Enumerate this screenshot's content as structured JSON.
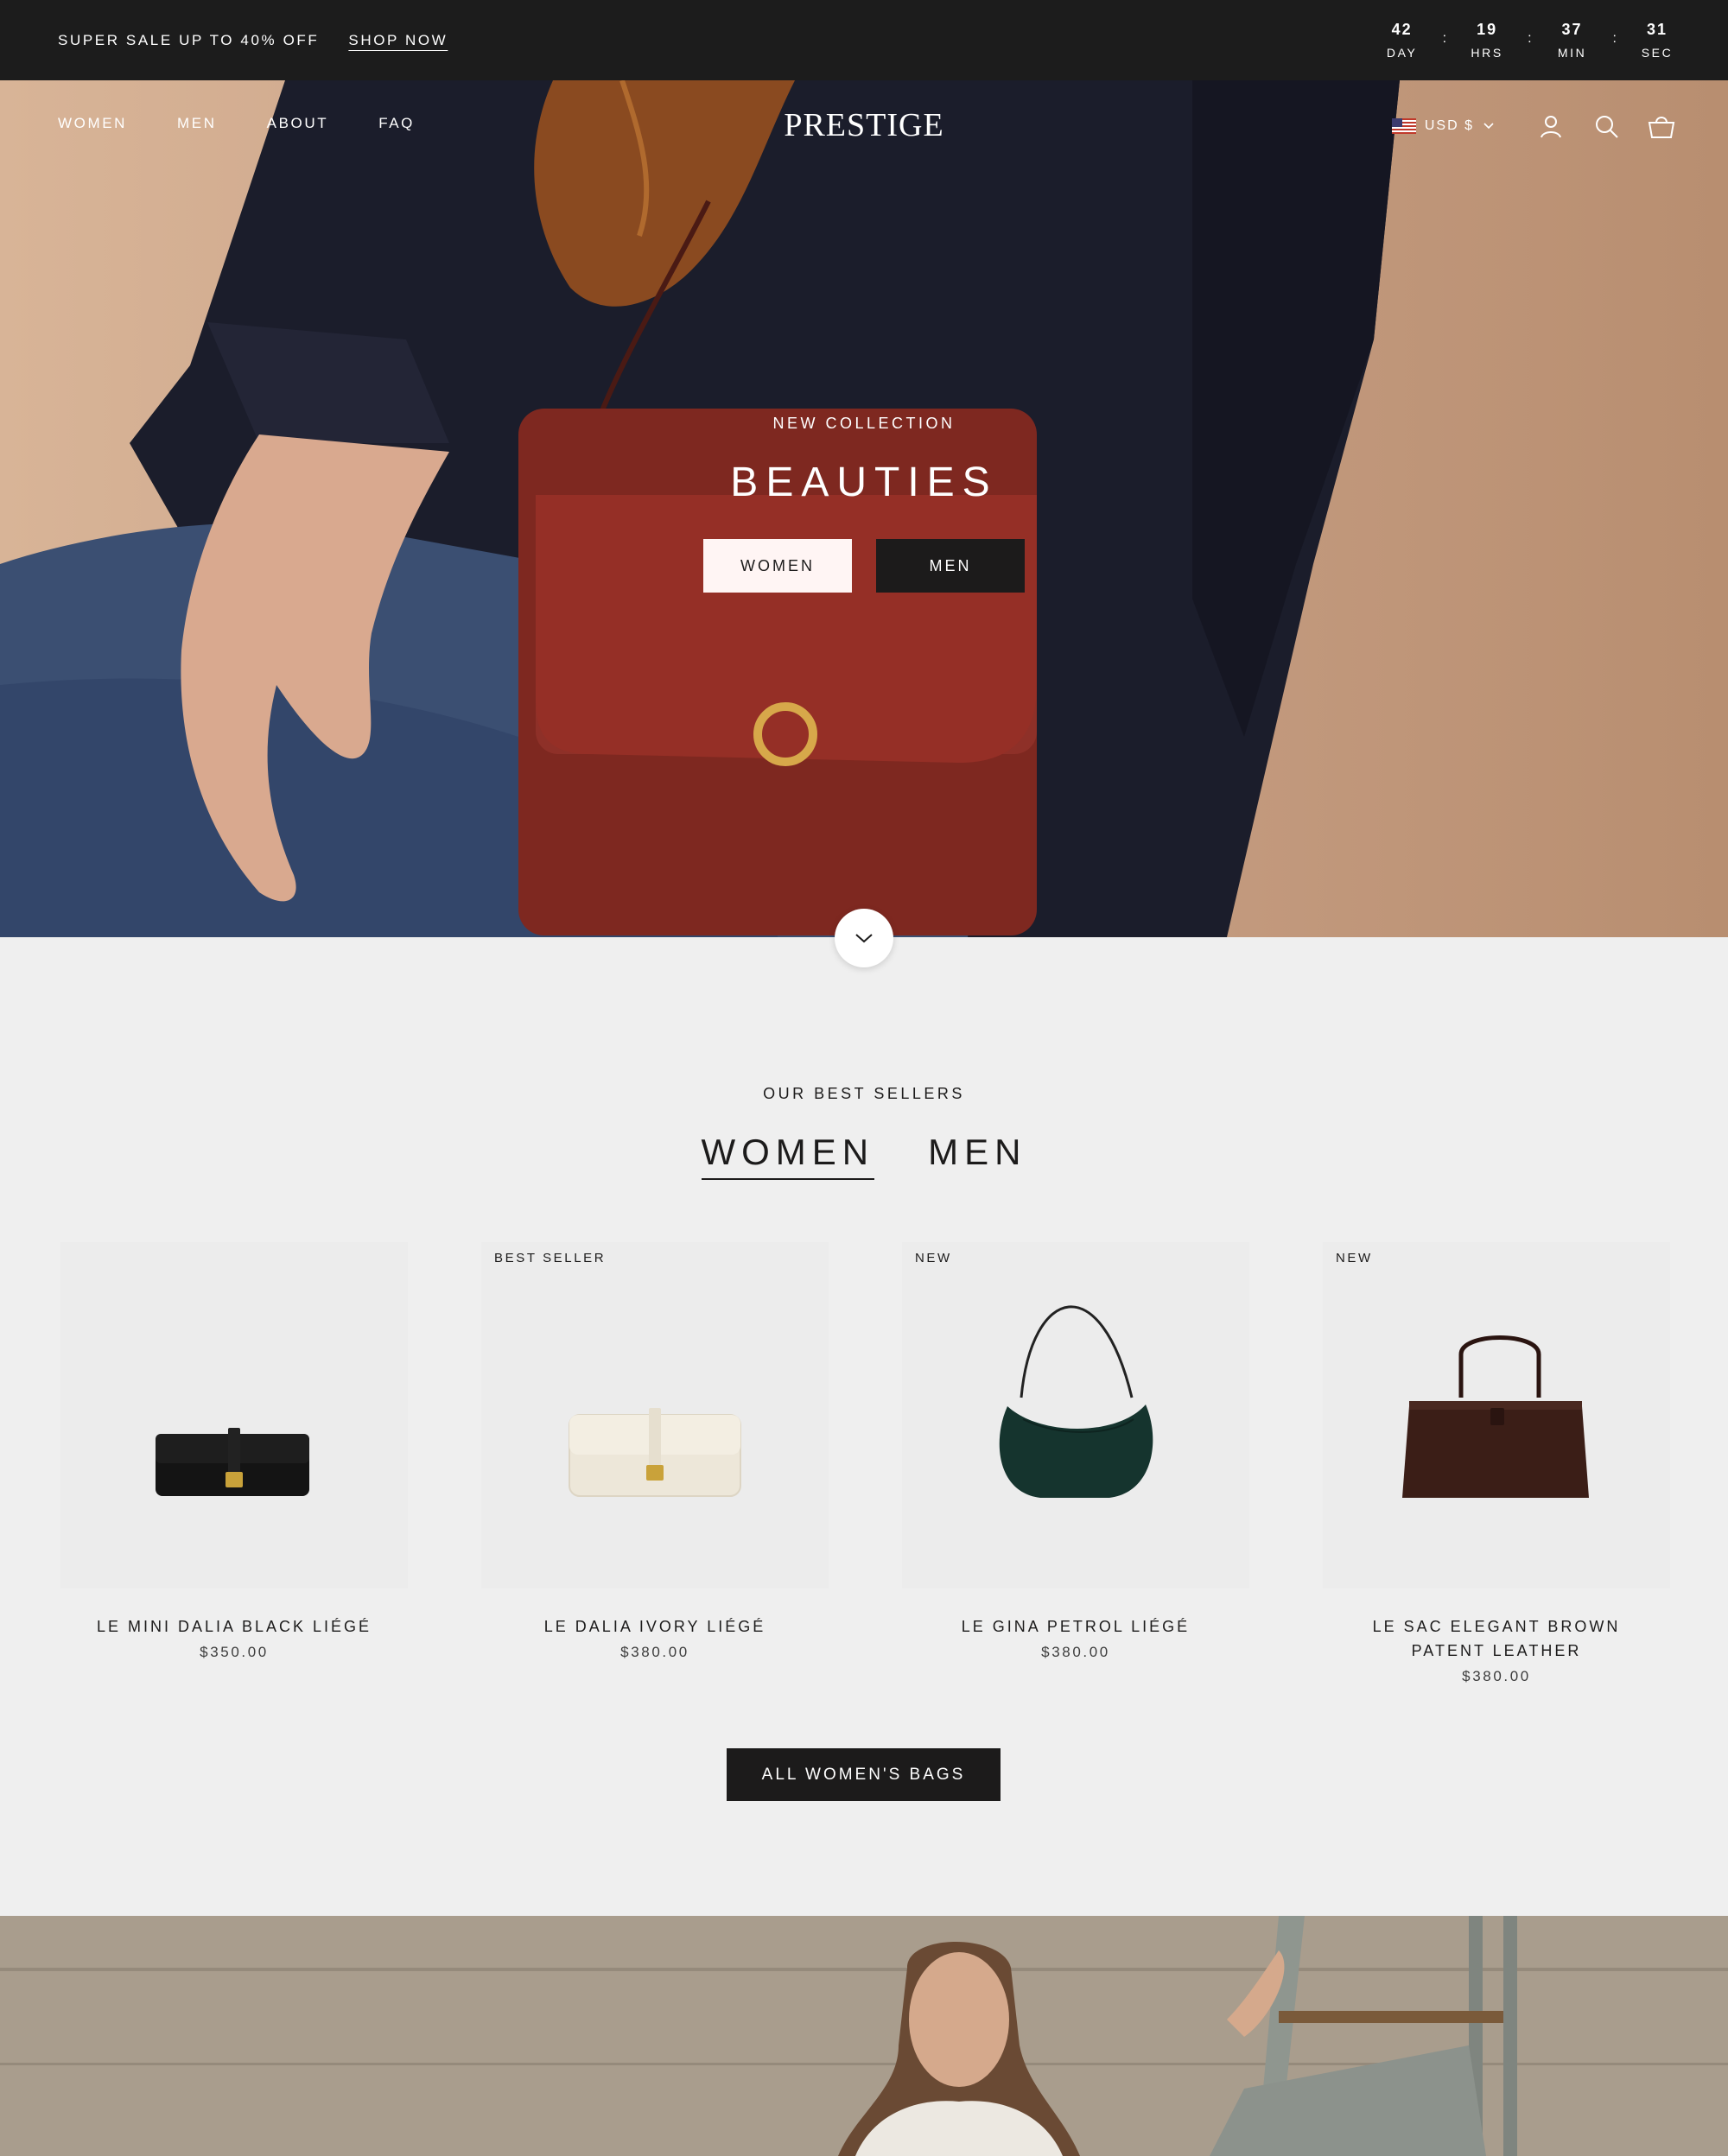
{
  "announcement": {
    "promo_text": "SUPER SALE UP TO 40% OFF",
    "shop_link": "SHOP NOW",
    "countdown": [
      {
        "value": "42",
        "label": "DAY"
      },
      {
        "value": "19",
        "label": "HRS"
      },
      {
        "value": "37",
        "label": "MIN"
      },
      {
        "value": "31",
        "label": "SEC"
      }
    ],
    "separator": ":"
  },
  "header": {
    "nav": [
      "WOMEN",
      "MEN",
      "ABOUT",
      "FAQ"
    ],
    "logo": "PRESTIGE",
    "currency": "USD $",
    "icons": [
      "us-flag-icon",
      "chevron-down-icon",
      "account-icon",
      "search-icon",
      "cart-icon"
    ]
  },
  "hero": {
    "subtitle": "NEW COLLECTION",
    "title": "BEAUTIES",
    "buttons": [
      "WOMEN",
      "MEN"
    ]
  },
  "best_sellers": {
    "eyebrow": "OUR BEST SELLERS",
    "tabs": [
      "WOMEN",
      "MEN"
    ],
    "active_tab": "WOMEN",
    "products": [
      {
        "badge": "",
        "name": "LE MINI DALIA BLACK LIÉGÉ",
        "price": "$350.00",
        "color": "#141414"
      },
      {
        "badge": "BEST SELLER",
        "name": "LE DALIA IVORY LIÉGÉ",
        "price": "$380.00",
        "color": "#efe9dc"
      },
      {
        "badge": "NEW",
        "name": "LE GINA PETROL LIÉGÉ",
        "price": "$380.00",
        "color": "#15342e"
      },
      {
        "badge": "NEW",
        "name": "LE SAC ELEGANT BROWN PATENT LEATHER",
        "price": "$380.00",
        "color": "#3b1e17"
      }
    ],
    "cta": "ALL WOMEN'S BAGS"
  },
  "colors": {
    "announcement_bg": "#1c1c1c",
    "text_dark": "#1c1b1b",
    "section_bg": "#efefef",
    "bag_red": "#8a2b22"
  }
}
